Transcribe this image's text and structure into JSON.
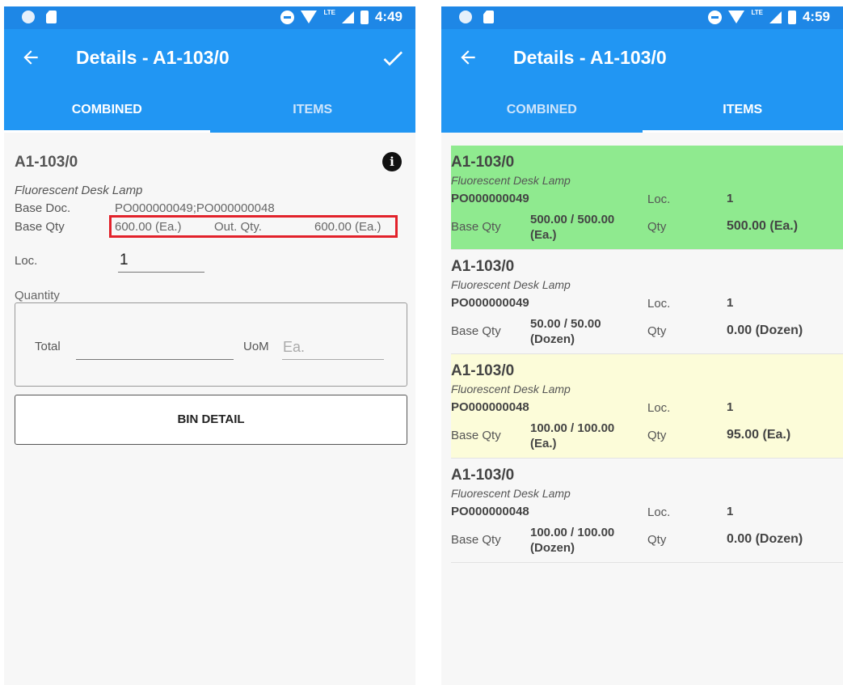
{
  "left": {
    "status": {
      "time": "4:49",
      "network": "LTE"
    },
    "title": "Details - A1-103/0",
    "tabs": [
      {
        "label": "COMBINED"
      },
      {
        "label": "ITEMS"
      }
    ],
    "item_code": "A1-103/0",
    "description": "Fluorescent Desk Lamp",
    "base_doc_label": "Base Doc.",
    "base_doc_value": "PO000000049;PO000000048",
    "base_qty_label": "Base Qty",
    "base_qty_value": "600.00 (Ea.)",
    "out_qty_label": "Out. Qty.",
    "out_qty_value": "600.00 (Ea.)",
    "loc_label": "Loc.",
    "loc_value": "1",
    "quantity_caption": "Quantity",
    "total_label": "Total",
    "total_value": "",
    "uom_label": "UoM",
    "uom_placeholder": "Ea.",
    "bin_detail_label": "BIN DETAIL",
    "highlight_color": "#e2222b"
  },
  "right": {
    "status": {
      "time": "4:59",
      "network": "LTE"
    },
    "title": "Details - A1-103/0",
    "tabs": [
      {
        "label": "COMBINED"
      },
      {
        "label": "ITEMS"
      }
    ],
    "rows": [
      {
        "code": "A1-103/0",
        "desc": "Fluorescent Desk Lamp",
        "po": "PO000000049",
        "loc_label": "Loc.",
        "loc": "1",
        "base_qty_label": "Base Qty",
        "base_qty": "500.00 / 500.00 (Ea.)",
        "qty_label": "Qty",
        "qty": "500.00 (Ea.)",
        "color": "#8fea8f"
      },
      {
        "code": "A1-103/0",
        "desc": "Fluorescent Desk Lamp",
        "po": "PO000000049",
        "loc_label": "Loc.",
        "loc": "1",
        "base_qty_label": "Base Qty",
        "base_qty": "50.00 / 50.00 (Dozen)",
        "qty_label": "Qty",
        "qty": "0.00 (Dozen)",
        "color": "#f7f7f7"
      },
      {
        "code": "A1-103/0",
        "desc": "Fluorescent Desk Lamp",
        "po": "PO000000048",
        "loc_label": "Loc.",
        "loc": "1",
        "base_qty_label": "Base Qty",
        "base_qty": "100.00 / 100.00 (Ea.)",
        "qty_label": "Qty",
        "qty": "95.00 (Ea.)",
        "color": "#fcfcd9"
      },
      {
        "code": "A1-103/0",
        "desc": "Fluorescent Desk Lamp",
        "po": "PO000000048",
        "loc_label": "Loc.",
        "loc": "1",
        "base_qty_label": "Base Qty",
        "base_qty": "100.00 / 100.00 (Dozen)",
        "qty_label": "Qty",
        "qty": "0.00 (Dozen)",
        "color": "#f7f7f7"
      }
    ]
  },
  "colors": {
    "appbar": "#2196f3",
    "statusbar": "#1e87e6"
  }
}
